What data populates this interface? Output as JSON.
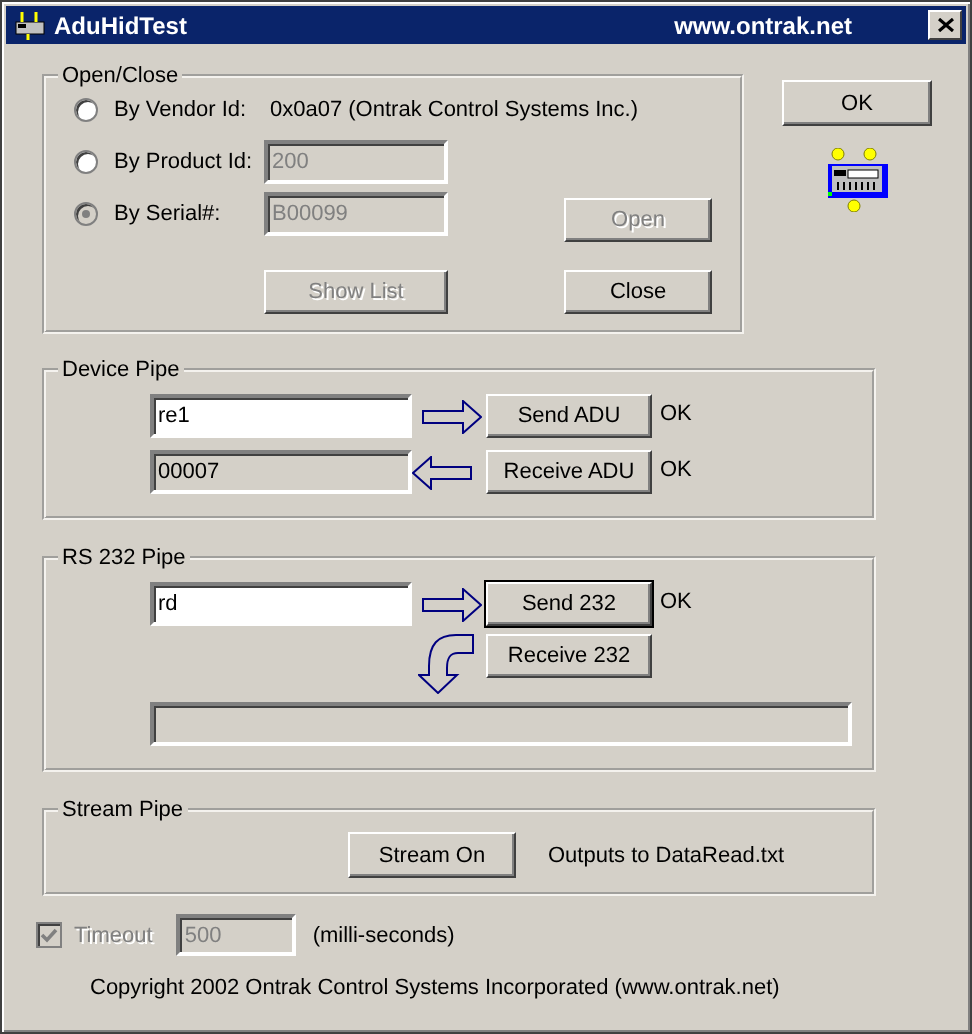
{
  "window": {
    "title": "AduHidTest",
    "site": "www.ontrak.net"
  },
  "open_close": {
    "title": "Open/Close",
    "options": [
      {
        "label": "By Vendor Id:",
        "kind": "text",
        "value": "0x0a07 (Ontrak Control Systems Inc.)",
        "selected": false,
        "disabled": false
      },
      {
        "label": "By Product Id:",
        "kind": "field",
        "value": "200",
        "selected": false,
        "disabled": false
      },
      {
        "label": "By Serial#:",
        "kind": "field",
        "value": "B00099",
        "selected": true,
        "disabled": true
      }
    ],
    "buttons": [
      {
        "label": "Open",
        "disabled": true
      },
      {
        "label": "Show List",
        "disabled": true
      },
      {
        "label": "Close",
        "disabled": false
      }
    ]
  },
  "ok_button": {
    "label": "OK"
  },
  "device_pipe": {
    "title": "Device Pipe",
    "rows": [
      {
        "kind": "send",
        "value": "re1",
        "editable": true,
        "button": "Send ADU",
        "status": "OK",
        "focused": false
      },
      {
        "kind": "receive",
        "value": "00007",
        "editable": false,
        "button": "Receive ADU",
        "status": "OK",
        "focused": false
      }
    ]
  },
  "rs232_pipe": {
    "title": "RS 232 Pipe",
    "rows": [
      {
        "kind": "send",
        "value": "rd",
        "editable": true,
        "button": "Send 232",
        "status": "OK",
        "focused": true
      },
      {
        "kind": "return",
        "button": "Receive 232",
        "focused": false
      }
    ]
  },
  "stream_pipe": {
    "title": "Stream Pipe",
    "button": "Stream On",
    "note": "Outputs to DataRead.txt"
  },
  "timeout": {
    "label": "Timeout",
    "checked": true,
    "disabled": true,
    "value": "500",
    "unit": "(milli-seconds)"
  },
  "copyright": "Copyright 2002 Ontrak Control Systems Incorporated (www.ontrak.net)"
}
